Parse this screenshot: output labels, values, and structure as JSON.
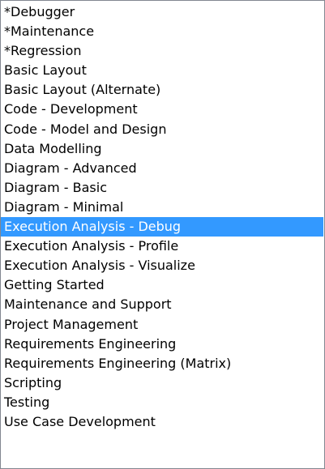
{
  "listbox": {
    "selected_index": 11,
    "selection_color": "#3399ff",
    "items": [
      "*Debugger",
      "*Maintenance",
      "*Regression",
      "Basic Layout",
      "Basic Layout (Alternate)",
      "Code - Development",
      "Code - Model and Design",
      "Data Modelling",
      "Diagram - Advanced",
      "Diagram - Basic",
      "Diagram - Minimal",
      "Execution Analysis - Debug",
      "Execution Analysis - Profile",
      "Execution Analysis - Visualize",
      "Getting Started",
      "Maintenance and Support",
      "Project Management",
      "Requirements Engineering",
      "Requirements Engineering (Matrix)",
      "Scripting",
      "Testing",
      "Use Case Development"
    ]
  }
}
